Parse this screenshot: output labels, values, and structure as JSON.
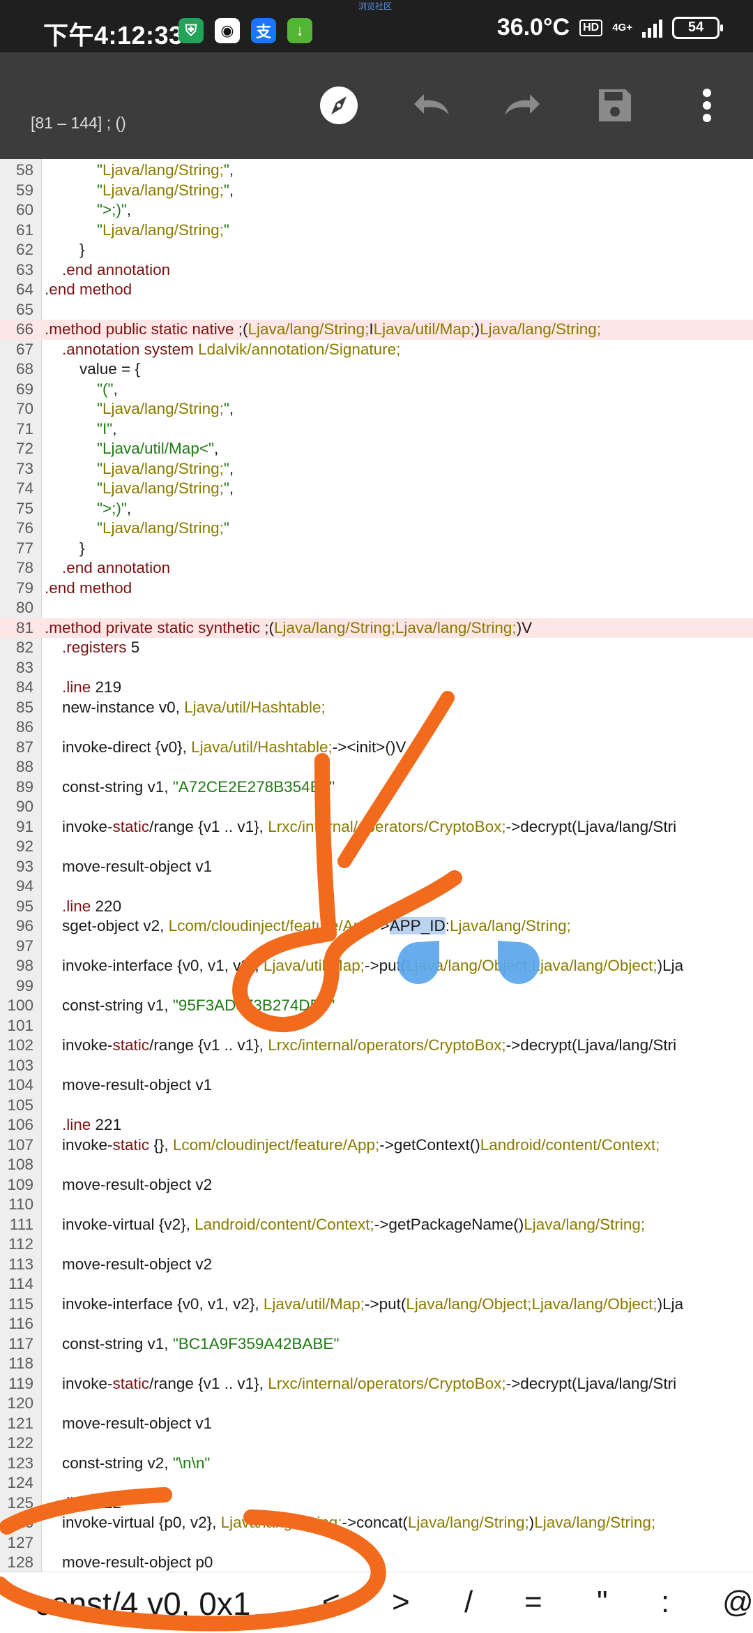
{
  "status_bar": {
    "time": "下午4:12:33",
    "center_mark": "浏览社区",
    "temperature": "36.0°C",
    "hd": "HD",
    "network": "4G+",
    "battery": "54"
  },
  "toolbar": {
    "range_label": "[81 – 144] ; ()"
  },
  "code_lines": [
    {
      "n": "58",
      "t": "            \"Ljava/lang/String;\","
    },
    {
      "n": "59",
      "t": "            \"Ljava/lang/String;\","
    },
    {
      "n": "60",
      "t": "            \">;)\","
    },
    {
      "n": "61",
      "t": "            \"Ljava/lang/String;\""
    },
    {
      "n": "62",
      "t": "        }"
    },
    {
      "n": "63",
      "t": "    .end annotation"
    },
    {
      "n": "64",
      "t": ".end method"
    },
    {
      "n": "65",
      "t": ""
    },
    {
      "n": "66",
      "t": ".method public static native ;(Ljava/lang/String;ILjava/util/Map;)Ljava/lang/String;"
    },
    {
      "n": "67",
      "t": "    .annotation system Ldalvik/annotation/Signature;"
    },
    {
      "n": "68",
      "t": "        value = {"
    },
    {
      "n": "69",
      "t": "            \"(\","
    },
    {
      "n": "70",
      "t": "            \"Ljava/lang/String;\","
    },
    {
      "n": "71",
      "t": "            \"I\","
    },
    {
      "n": "72",
      "t": "            \"Ljava/util/Map<\","
    },
    {
      "n": "73",
      "t": "            \"Ljava/lang/String;\","
    },
    {
      "n": "74",
      "t": "            \"Ljava/lang/String;\","
    },
    {
      "n": "75",
      "t": "            \">;)\","
    },
    {
      "n": "76",
      "t": "            \"Ljava/lang/String;\""
    },
    {
      "n": "77",
      "t": "        }"
    },
    {
      "n": "78",
      "t": "    .end annotation"
    },
    {
      "n": "79",
      "t": ".end method"
    },
    {
      "n": "80",
      "t": ""
    },
    {
      "n": "81",
      "t": ".method private static synthetic ;(Ljava/lang/String;Ljava/lang/String;)V"
    },
    {
      "n": "82",
      "t": "    .registers 5"
    },
    {
      "n": "83",
      "t": ""
    },
    {
      "n": "84",
      "t": "    .line 219"
    },
    {
      "n": "85",
      "t": "    new-instance v0, Ljava/util/Hashtable;"
    },
    {
      "n": "86",
      "t": ""
    },
    {
      "n": "87",
      "t": "    invoke-direct {v0}, Ljava/util/Hashtable;-><init>()V"
    },
    {
      "n": "88",
      "t": ""
    },
    {
      "n": "89",
      "t": "    const-string v1, \"A72CE2E278B354E6\""
    },
    {
      "n": "90",
      "t": ""
    },
    {
      "n": "91",
      "t": "    invoke-static/range {v1 .. v1}, Lrxc/internal/operators/CryptoBox;->decrypt(Ljava/lang/Stri"
    },
    {
      "n": "92",
      "t": ""
    },
    {
      "n": "93",
      "t": "    move-result-object v1"
    },
    {
      "n": "94",
      "t": ""
    },
    {
      "n": "95",
      "t": "    .line 220"
    },
    {
      "n": "96",
      "t": "    sget-object v2, Lcom/cloudinject/feature/App;->APP_ID:Ljava/lang/String;"
    },
    {
      "n": "97",
      "t": ""
    },
    {
      "n": "98",
      "t": "    invoke-interface {v0, v1, v2}, Ljava/util/Map;->put(Ljava/lang/Object;Ljava/lang/Object;)Lja"
    },
    {
      "n": "99",
      "t": ""
    },
    {
      "n": "100",
      "t": "    const-string v1, \"95F3AD373B274DB4\""
    },
    {
      "n": "101",
      "t": ""
    },
    {
      "n": "102",
      "t": "    invoke-static/range {v1 .. v1}, Lrxc/internal/operators/CryptoBox;->decrypt(Ljava/lang/Stri"
    },
    {
      "n": "103",
      "t": ""
    },
    {
      "n": "104",
      "t": "    move-result-object v1"
    },
    {
      "n": "105",
      "t": ""
    },
    {
      "n": "106",
      "t": "    .line 221"
    },
    {
      "n": "107",
      "t": "    invoke-static {}, Lcom/cloudinject/feature/App;->getContext()Landroid/content/Context;"
    },
    {
      "n": "108",
      "t": ""
    },
    {
      "n": "109",
      "t": "    move-result-object v2"
    },
    {
      "n": "110",
      "t": ""
    },
    {
      "n": "111",
      "t": "    invoke-virtual {v2}, Landroid/content/Context;->getPackageName()Ljava/lang/String;"
    },
    {
      "n": "112",
      "t": ""
    },
    {
      "n": "113",
      "t": "    move-result-object v2"
    },
    {
      "n": "114",
      "t": ""
    },
    {
      "n": "115",
      "t": "    invoke-interface {v0, v1, v2}, Ljava/util/Map;->put(Ljava/lang/Object;Ljava/lang/Object;)Lja"
    },
    {
      "n": "116",
      "t": ""
    },
    {
      "n": "117",
      "t": "    const-string v1, \"BC1A9F359A42BABE\""
    },
    {
      "n": "118",
      "t": ""
    },
    {
      "n": "119",
      "t": "    invoke-static/range {v1 .. v1}, Lrxc/internal/operators/CryptoBox;->decrypt(Ljava/lang/Stri"
    },
    {
      "n": "120",
      "t": ""
    },
    {
      "n": "121",
      "t": "    move-result-object v1"
    },
    {
      "n": "122",
      "t": ""
    },
    {
      "n": "123",
      "t": "    const-string v2, \"\\n\\n\""
    },
    {
      "n": "124",
      "t": ""
    },
    {
      "n": "125",
      "t": "    .line 222"
    },
    {
      "n": "126",
      "t": "    invoke-virtual {p0, v2}, Ljava/lang/String;->concat(Ljava/lang/String;)Ljava/lang/String;"
    },
    {
      "n": "127",
      "t": ""
    },
    {
      "n": "128",
      "t": "    move-result-object p0"
    }
  ],
  "highlighted_lines": [
    "66",
    "81"
  ],
  "selection": {
    "line": "96",
    "text": "APP_ID"
  },
  "symbol_bar": {
    "suggestion": "const/4 v0, 0x1",
    "symbols": [
      "<",
      ">",
      "/",
      "=",
      "\"",
      ":",
      "@"
    ]
  },
  "colors": {
    "status_bg": "#1f1f1f",
    "toolbar_bg": "#3c3c3c",
    "highlight_bg": "#fde6e6",
    "selection_bg": "#b9d3f0",
    "keyword": "#7a1212",
    "type": "#8a7a00",
    "string": "#1d7a12",
    "annotation_stroke": "#f26a1b",
    "handle": "#5aa6ec"
  }
}
